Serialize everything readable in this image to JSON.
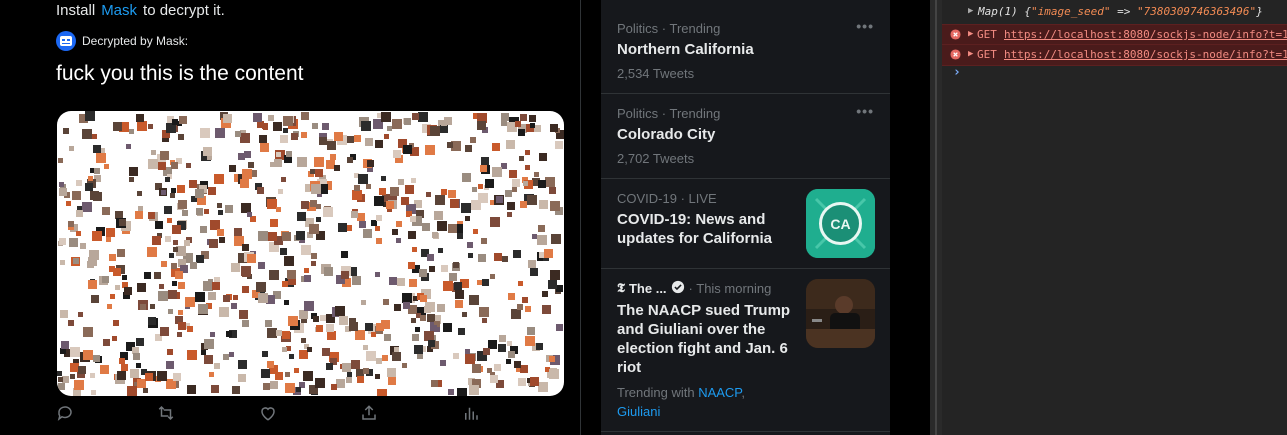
{
  "post": {
    "install_prefix": "Install",
    "install_link": "Mask",
    "install_suffix": "to decrypt it.",
    "decrypted_by": "Decrypted by Mask:",
    "content": "fuck you this is the content"
  },
  "trends": [
    {
      "meta": "Politics · Trending",
      "title": "Northern California",
      "count": "2,534 Tweets"
    },
    {
      "meta": "Politics · Trending",
      "title": "Colorado City",
      "count": "2,702 Tweets"
    },
    {
      "meta": "COVID-19 · LIVE",
      "title": "COVID-19: News and updates for California",
      "thumb_label": "CA"
    },
    {
      "source": "The ...",
      "time": "· This morning",
      "title": "The NAACP sued Trump and Giuliani over the election fight and Jan. 6 riot",
      "trending_with": "Trending with",
      "links": [
        "NAACP",
        "Giuliani"
      ]
    }
  ],
  "console": {
    "map_line": {
      "prefix": "Map(1) {",
      "key": "\"image_seed\"",
      "arrow": " => ",
      "value": "\"7380309746363496\"",
      "suffix": "}"
    },
    "errors": [
      {
        "method": "GET",
        "url": "https://localhost:8080/sockjs-node/info?t=1"
      },
      {
        "method": "GET",
        "url": "https://localhost:8080/sockjs-node/info?t=1"
      }
    ],
    "prompt": "›"
  },
  "colors": {
    "accent": "#1d9bf0",
    "error_bg": "#4a1b1b",
    "covid_thumb": "#1fae8f"
  }
}
